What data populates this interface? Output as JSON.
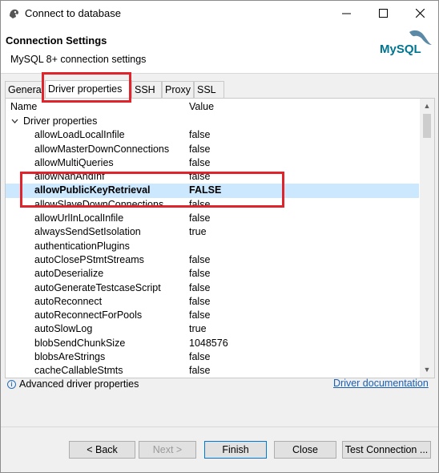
{
  "window": {
    "title": "Connect to database"
  },
  "header": {
    "title": "Connection Settings",
    "subtitle": "MySQL 8+ connection settings",
    "logo_text": "MySQL"
  },
  "tabs": [
    {
      "label": "General"
    },
    {
      "label": "Driver properties"
    },
    {
      "label": "SSH"
    },
    {
      "label": "Proxy"
    },
    {
      "label": "SSL"
    }
  ],
  "table": {
    "columns": [
      "Name",
      "Value"
    ],
    "group_label": "Driver properties",
    "rows": [
      {
        "name": "allowLoadLocalInfile",
        "value": "false"
      },
      {
        "name": "allowMasterDownConnections",
        "value": "false"
      },
      {
        "name": "allowMultiQueries",
        "value": "false"
      },
      {
        "name": "allowNanAndInf",
        "value": "false"
      },
      {
        "name": "allowPublicKeyRetrieval",
        "value": "FALSE"
      },
      {
        "name": "allowSlaveDownConnections",
        "value": "false"
      },
      {
        "name": "allowUrlInLocalInfile",
        "value": "false"
      },
      {
        "name": "alwaysSendSetIsolation",
        "value": "true"
      },
      {
        "name": "authenticationPlugins",
        "value": ""
      },
      {
        "name": "autoClosePStmtStreams",
        "value": "false"
      },
      {
        "name": "autoDeserialize",
        "value": "false"
      },
      {
        "name": "autoGenerateTestcaseScript",
        "value": "false"
      },
      {
        "name": "autoReconnect",
        "value": "false"
      },
      {
        "name": "autoReconnectForPools",
        "value": "false"
      },
      {
        "name": "autoSlowLog",
        "value": "true"
      },
      {
        "name": "blobSendChunkSize",
        "value": "1048576"
      },
      {
        "name": "blobsAreStrings",
        "value": "false"
      },
      {
        "name": "cacheCallableStmts",
        "value": "false"
      }
    ]
  },
  "footer": {
    "advanced_label": "Advanced driver properties",
    "doc_link": "Driver documentation"
  },
  "buttons": {
    "back": "< Back",
    "next": "Next >",
    "finish": "Finish",
    "close": "Close",
    "test": "Test Connection ..."
  },
  "colors": {
    "highlight": "#e0242b",
    "selection": "#cce8ff",
    "link": "#1a5fb4"
  }
}
